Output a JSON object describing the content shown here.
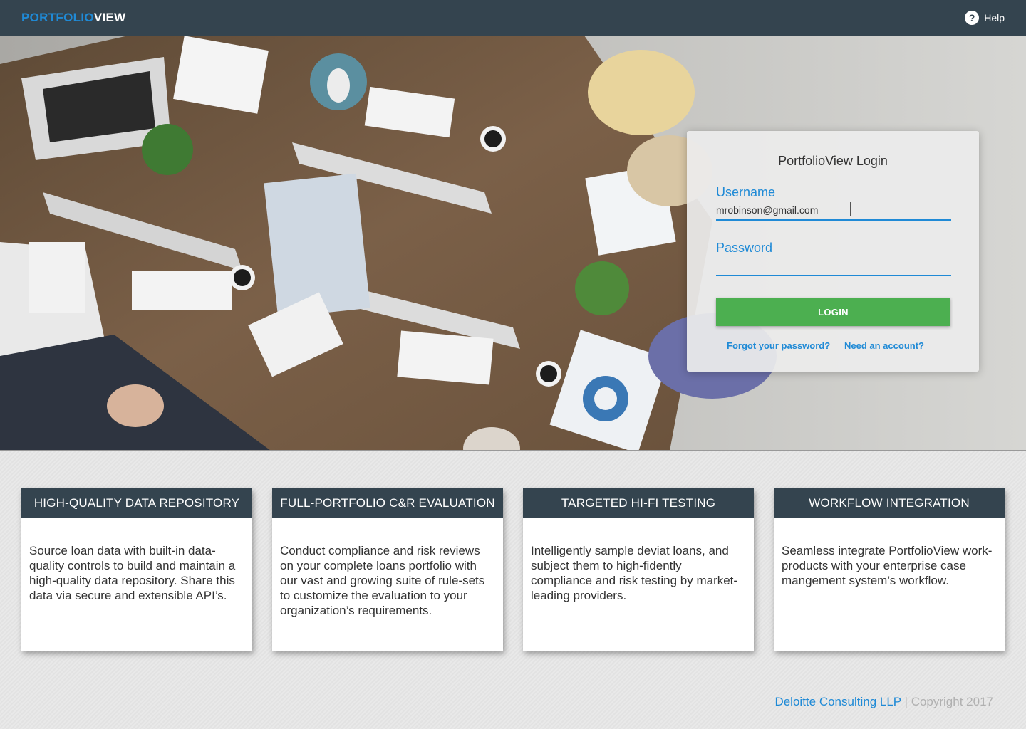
{
  "brand": {
    "part1": "PORTFOLIO",
    "part2": "VIEW"
  },
  "help": {
    "icon": "question-circle-icon",
    "label": "Help"
  },
  "login": {
    "title": "PortfolioView Login",
    "username_label": "Username",
    "username_value": "mrobinson@gmail.com",
    "password_label": "Password",
    "password_value": "",
    "button_label": "LOGIN",
    "forgot_link": "Forgot your password?",
    "signup_link": "Need an account?"
  },
  "features": [
    {
      "title": "HIGH-QUALITY DATA REPOSITORY",
      "body": "Source loan data with built-in data-quality controls to build and maintain a high-quality data repository. Share this data via secure and extensible API’s."
    },
    {
      "title": "FULL-PORTFOLIO C&R EVALUATION",
      "body": "Conduct compliance and risk reviews on your complete loans portfolio with our vast and growing suite of rule-sets to customize the evaluation to your organization’s requirements."
    },
    {
      "title": "TARGETED HI-FI TESTING",
      "body": "Intelligently sample deviat loans, and subject them to high-fidently compliance and risk testing by market- leading providers."
    },
    {
      "title": "WORKFLOW INTEGRATION",
      "body": "Seamless integrate PortfolioView work-products with your enterprise case mangement system’s workflow."
    }
  ],
  "footer": {
    "company": "Deloitte Consulting LLP",
    "separator": " | ",
    "copyright": "Copyright 2017"
  },
  "colors": {
    "nav": "#34444f",
    "accent": "#1f8ad6",
    "login_button": "#4caf50"
  }
}
